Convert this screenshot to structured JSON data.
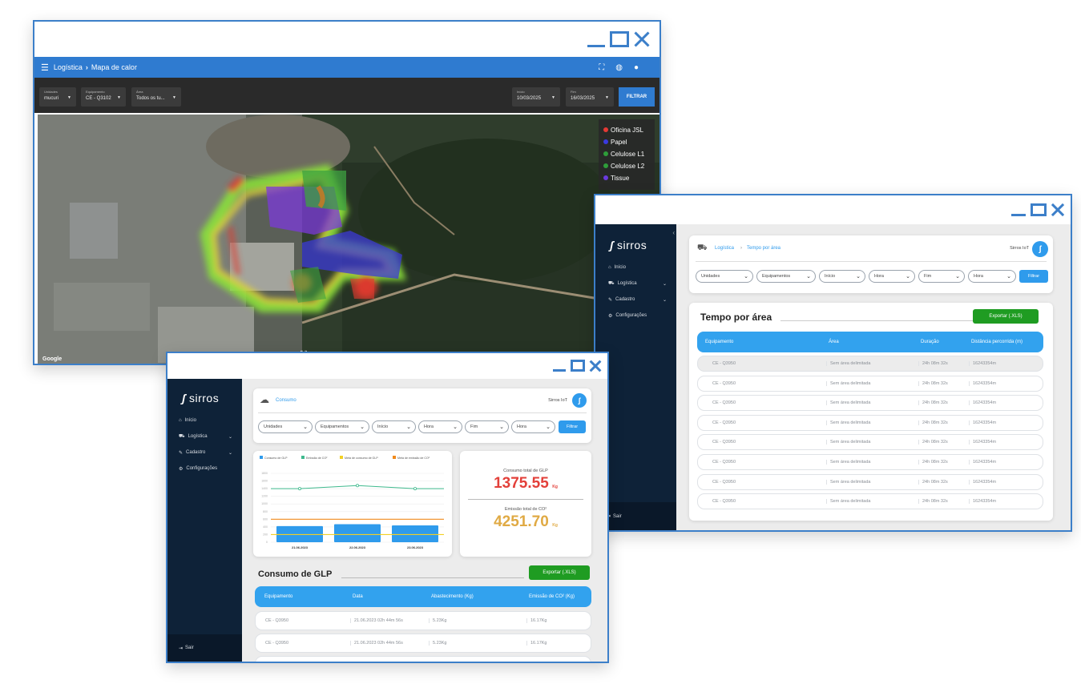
{
  "heatmap_window": {
    "breadcrumb": {
      "section": "Logística",
      "page": "Mapa de calor"
    },
    "filters": {
      "unidades": {
        "label": "Unidades",
        "value": "mucuri"
      },
      "equipamento": {
        "label": "Equipamento",
        "value": "CE - Q3102"
      },
      "area": {
        "label": "Área",
        "value": "Todos os tu..."
      },
      "inicio": {
        "label": "Início",
        "value": "10/03/2025"
      },
      "fim": {
        "label": "Fim",
        "value": "16/03/2025"
      },
      "filtrar_label": "FILTRAR"
    },
    "legend": [
      {
        "label": "Oficina JSL",
        "color": "#e53935"
      },
      {
        "label": "Papel",
        "color": "#3a3ae0"
      },
      {
        "label": "Celulose L1",
        "color": "#2e9d3a"
      },
      {
        "label": "Celulose L2",
        "color": "#2e9d3a"
      },
      {
        "label": "Tissue",
        "color": "#6a3ae0"
      }
    ],
    "map_attribution": "Google"
  },
  "tempo_window": {
    "logo": "sirros",
    "nav": [
      "Início",
      "Logística",
      "Cadastro",
      "Configurações"
    ],
    "sair": "Sair",
    "breadcrumb": {
      "section": "Logística",
      "page": "Tempo por área"
    },
    "brand_label": "Sirros IoT",
    "filters": [
      "Unidades",
      "Equipamentos",
      "Início",
      "Hora",
      "Fim",
      "Hora"
    ],
    "filtrar_label": "Filtrar",
    "title": "Tempo por área",
    "export_label": "Exportar (.XLS)",
    "columns": [
      "Equipamento",
      "Área",
      "Duração",
      "Distância percorrida (m)"
    ],
    "rows": [
      [
        "CE - Q3950",
        "Sem área delimitada",
        "24h 08m 32s",
        "16243354m"
      ],
      [
        "CE - Q3950",
        "Sem área delimitada",
        "24h 08m 32s",
        "16243354m"
      ],
      [
        "CE - Q3950",
        "Sem área delimitada",
        "24h 08m 32s",
        "16243354m"
      ],
      [
        "CE - Q3950",
        "Sem área delimitada",
        "24h 08m 32s",
        "16243354m"
      ],
      [
        "CE - Q3950",
        "Sem área delimitada",
        "24h 08m 32s",
        "16243354m"
      ],
      [
        "CE - Q3950",
        "Sem área delimitada",
        "24h 08m 32s",
        "16243354m"
      ],
      [
        "CE - Q3950",
        "Sem área delimitada",
        "24h 08m 32s",
        "16243354m"
      ],
      [
        "CE - Q3950",
        "Sem área delimitada",
        "24h 08m 32s",
        "16243354m"
      ]
    ]
  },
  "consumo_window": {
    "logo": "sirros",
    "nav": [
      "Início",
      "Logística",
      "Cadastro",
      "Configurações"
    ],
    "sair": "Sair",
    "breadcrumb": "Consumo",
    "brand_label": "Sirros IoT",
    "filters": [
      "Unidades",
      "Equipamentos",
      "Início",
      "Hora",
      "Fim",
      "Hora"
    ],
    "filtrar_label": "Filtrar",
    "kpi": {
      "glp_label": "Consumo total de GLP",
      "glp_value": "1375.55",
      "glp_unit": "Kg",
      "co2_label": "Emissão total de CO²",
      "co2_value": "4251.70",
      "co2_unit": "Kg"
    },
    "title": "Consumo de GLP",
    "export_label": "Exportar (.XLS)",
    "columns": [
      "Equipamento",
      "Data",
      "Abastecimento (Kg)",
      "Emissão de CO² (Kg)"
    ],
    "rows": [
      [
        "CE - Q3950",
        "21.06.2023 02h 44m 56s",
        "5.23Kg",
        "16.17Kg"
      ],
      [
        "CE - Q3950",
        "21.06.2023 02h 44m 56s",
        "5.23Kg",
        "16.17Kg"
      ]
    ]
  },
  "chart_data": {
    "type": "bar",
    "categories": [
      "21.06.2023",
      "22.06.2023",
      "23.06.2023"
    ],
    "series": [
      {
        "name": "Consumo de GLP",
        "type": "bar",
        "color": "#2f9bec",
        "values": [
          420,
          470,
          440
        ]
      },
      {
        "name": "Emissão de CO²",
        "type": "line",
        "color": "#3fb98d",
        "values": [
          1400,
          1480,
          1400
        ]
      },
      {
        "name": "Meta de consumo de GLP",
        "type": "line",
        "color": "#f2d024",
        "values": [
          200,
          200,
          200
        ]
      },
      {
        "name": "Meta de emissão de CO²",
        "type": "line",
        "color": "#f08a1c",
        "values": [
          600,
          600,
          600
        ]
      }
    ],
    "yticks": [
      0,
      200,
      400,
      600,
      800,
      1000,
      1200,
      1400,
      1600,
      1800
    ],
    "ylim": [
      0,
      1800
    ]
  }
}
